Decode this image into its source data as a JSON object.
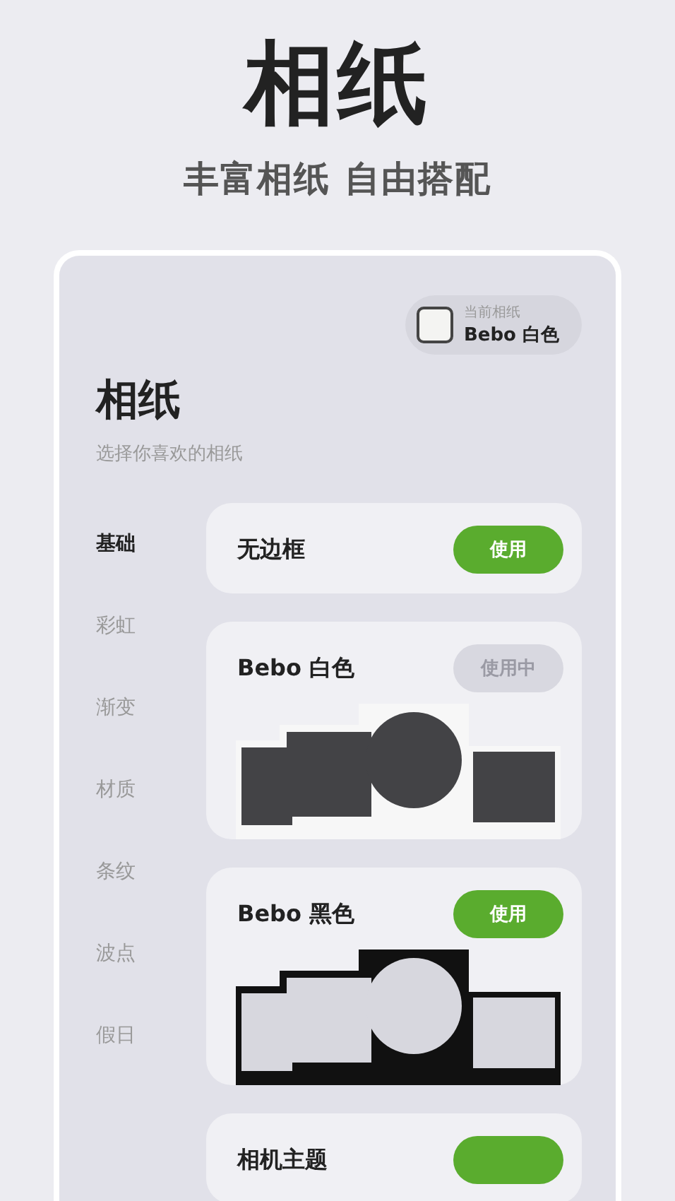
{
  "headline": "相纸",
  "tagline": "丰富相纸 自由搭配",
  "current": {
    "caption": "当前相纸",
    "name": "Bebo 白色"
  },
  "screen": {
    "title": "相纸",
    "subtitle": "选择你喜欢的相纸"
  },
  "categories": [
    {
      "label": "基础",
      "selected": true
    },
    {
      "label": "彩虹",
      "selected": false
    },
    {
      "label": "渐变",
      "selected": false
    },
    {
      "label": "材质",
      "selected": false
    },
    {
      "label": "条纹",
      "selected": false
    },
    {
      "label": "波点",
      "selected": false
    },
    {
      "label": "假日",
      "selected": false
    }
  ],
  "papers": [
    {
      "kind": "plain",
      "title": "无边框",
      "button": "使用",
      "in_use": false
    },
    {
      "kind": "white",
      "title": "Bebo 白色",
      "button": "使用中",
      "in_use": true
    },
    {
      "kind": "black",
      "title": "Bebo 黑色",
      "button": "使用",
      "in_use": false
    },
    {
      "kind": "plain",
      "title": "相机主题",
      "in_use": false
    }
  ]
}
